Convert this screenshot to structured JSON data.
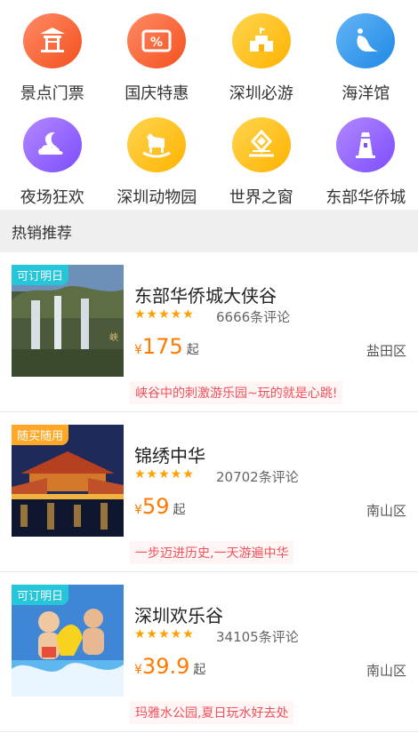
{
  "categories": [
    {
      "label": "景点门票",
      "icon": "pavilion-icon",
      "color": "red"
    },
    {
      "label": "国庆特惠",
      "icon": "discount-ticket-icon",
      "color": "red"
    },
    {
      "label": "深圳必游",
      "icon": "castle-icon",
      "color": "yellow"
    },
    {
      "label": "海洋馆",
      "icon": "seal-icon",
      "color": "blue"
    },
    {
      "label": "夜场狂欢",
      "icon": "moon-cloud-icon",
      "color": "purple"
    },
    {
      "label": "深圳动物园",
      "icon": "rocking-horse-icon",
      "color": "yellow"
    },
    {
      "label": "世界之窗",
      "icon": "landmark-diamond-icon",
      "color": "yellow"
    },
    {
      "label": "东部华侨城",
      "icon": "lighthouse-icon",
      "color": "purple"
    }
  ],
  "section": {
    "title": "热销推荐"
  },
  "products": [
    {
      "tag": "可订明日",
      "tag_color": "#26c6da",
      "name": "东部华侨城大侠谷",
      "stars": "★★★★★",
      "reviews": "6666条评论",
      "currency": "¥",
      "price": "175",
      "unit": "起",
      "district": "盐田区",
      "slogan": "峡谷中的刺激游乐园~玩的就是心跳!"
    },
    {
      "tag": "随买随用",
      "tag_color": "#ffa726",
      "name": "锦绣中华",
      "stars": "★★★★★",
      "reviews": "20702条评论",
      "currency": "¥",
      "price": "59",
      "unit": "起",
      "district": "南山区",
      "slogan": "一步迈进历史,一天游遍中华"
    },
    {
      "tag": "可订明日",
      "tag_color": "#26c6da",
      "name": "深圳欢乐谷",
      "stars": "★★★★★",
      "reviews": "34105条评论",
      "currency": "¥",
      "price": "39.9",
      "unit": "起",
      "district": "南山区",
      "slogan": "玛雅水公园,夏日玩水好去处"
    }
  ]
}
